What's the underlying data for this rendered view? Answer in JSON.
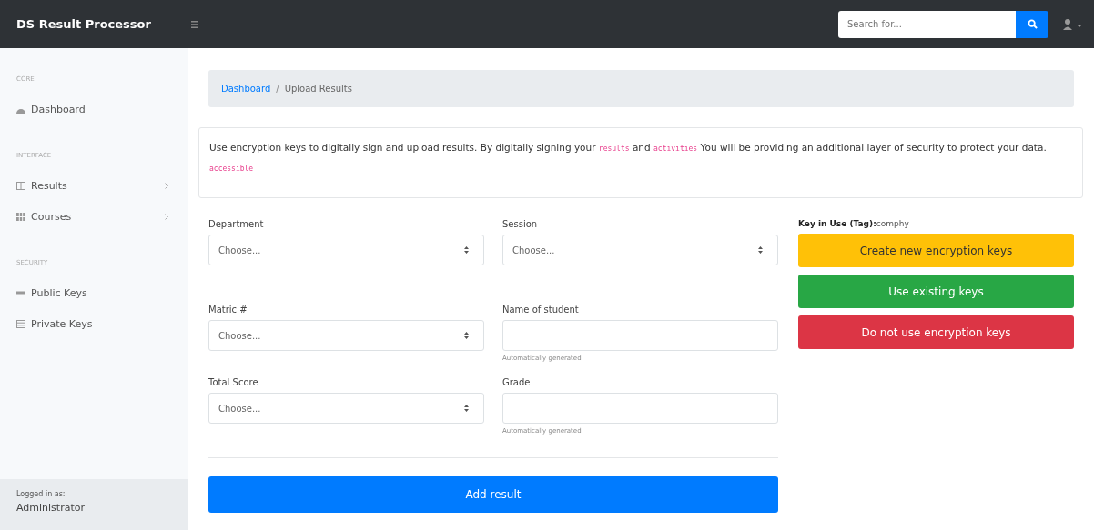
{
  "topbar": {
    "brand": "DS Result Processor",
    "search": {
      "placeholder": "Search for..."
    }
  },
  "sidebar": {
    "sections": [
      {
        "heading": "CORE",
        "items": [
          {
            "label": "Dashboard",
            "kind": "gauge",
            "expandable": false
          }
        ]
      },
      {
        "heading": "INTERFACE",
        "items": [
          {
            "label": "Results",
            "kind": "columns",
            "expandable": true
          },
          {
            "label": "Courses",
            "kind": "table",
            "expandable": true
          }
        ]
      },
      {
        "heading": "SECURITY",
        "items": [
          {
            "label": "Public Keys",
            "kind": "key",
            "expandable": false
          },
          {
            "label": "Private Keys",
            "kind": "list",
            "expandable": false
          }
        ]
      }
    ],
    "footer": {
      "caption": "Logged in as:",
      "user": "Administrator"
    }
  },
  "breadcrumb": [
    {
      "label": "Dashboard",
      "link": true
    },
    {
      "separator": "/",
      "label": "Upload Results",
      "link": false
    }
  ],
  "intro": [
    {
      "kind": "text",
      "text": "Use encryption keys to digitally sign and upload results. By digitally signing your "
    },
    {
      "kind": "code",
      "text": "results"
    },
    {
      "kind": "text",
      "text": " and "
    },
    {
      "kind": "code",
      "text": "activities"
    },
    {
      "kind": "text",
      "text": " You will be providing an additional layer of security to protect your data. "
    },
    {
      "kind": "code",
      "text": "accessible"
    }
  ],
  "form": {
    "rows": [
      [
        {
          "label": "Department",
          "kind": "select",
          "value": "Choose..."
        },
        {
          "label": "Session",
          "kind": "select",
          "value": "Choose..."
        }
      ],
      [
        {
          "label": "Matric #",
          "kind": "select",
          "value": "Choose..."
        },
        {
          "label": "Name of student",
          "kind": "text",
          "help": "Automatically generated"
        }
      ],
      [
        {
          "label": "Total Score",
          "kind": "select",
          "value": "Choose..."
        },
        {
          "label": "Grade",
          "kind": "text",
          "help": "Automatically generated"
        }
      ]
    ],
    "submit": "Add result"
  },
  "keys": {
    "in_use": "**Key in Use (Tag):**comphy",
    "buttons": [
      {
        "label": "Create new encryption keys",
        "kind": "warning"
      },
      {
        "label": "Use existing keys",
        "kind": "success"
      },
      {
        "label": "Do not use encryption keys",
        "kind": "danger"
      }
    ]
  }
}
